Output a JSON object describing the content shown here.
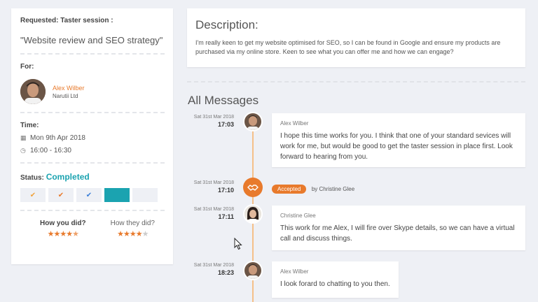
{
  "request": {
    "label": "Requested: Taster session :",
    "title": "\"Website review and SEO strategy\""
  },
  "for": {
    "label": "For:",
    "name": "Alex Wilber",
    "company": "Narutii Ltd"
  },
  "time": {
    "label": "Time:",
    "date": "Mon 9th Apr 2018",
    "range": "16:00 - 16:30"
  },
  "status": {
    "label": "Status:",
    "value": "Completed"
  },
  "ratings": {
    "you_label": "How you did?",
    "you_stars": 4.5,
    "they_label": "How they did?",
    "they_stars": 4
  },
  "description": {
    "heading": "Description:",
    "text": "I'm really keen to get my website optimised for SEO, so I can be found in Google and ensure my products are purchased via my online store. Keen to see what you can offer me and how we can engage?"
  },
  "messages_heading": "All Messages",
  "messages": [
    {
      "date": "Sat 31st Mar 2018",
      "time": "17:03",
      "from": "Alex Wilber",
      "body": "I hope this time works for you. I think that one of your standard sevices will work for me, but would be good to get the taster session in place first. Look forward to hearing from you."
    },
    {
      "date": "Sat 31st Mar 2018",
      "time": "17:10",
      "badge": "Accepted",
      "by": "by Christine Glee"
    },
    {
      "date": "Sat 31st Mar 2018",
      "time": "17:11",
      "from": "Christine Glee",
      "body": "This work for me Alex, I will fire over Skype details, so we can have a virtual call and discuss things."
    },
    {
      "date": "Sat 31st Mar 2018",
      "time": "18:23",
      "from": "Alex Wilber",
      "body": "I look forard to chatting to you then."
    }
  ],
  "colors": {
    "accent": "#e87a2c",
    "completed": "#1ba3b0"
  }
}
